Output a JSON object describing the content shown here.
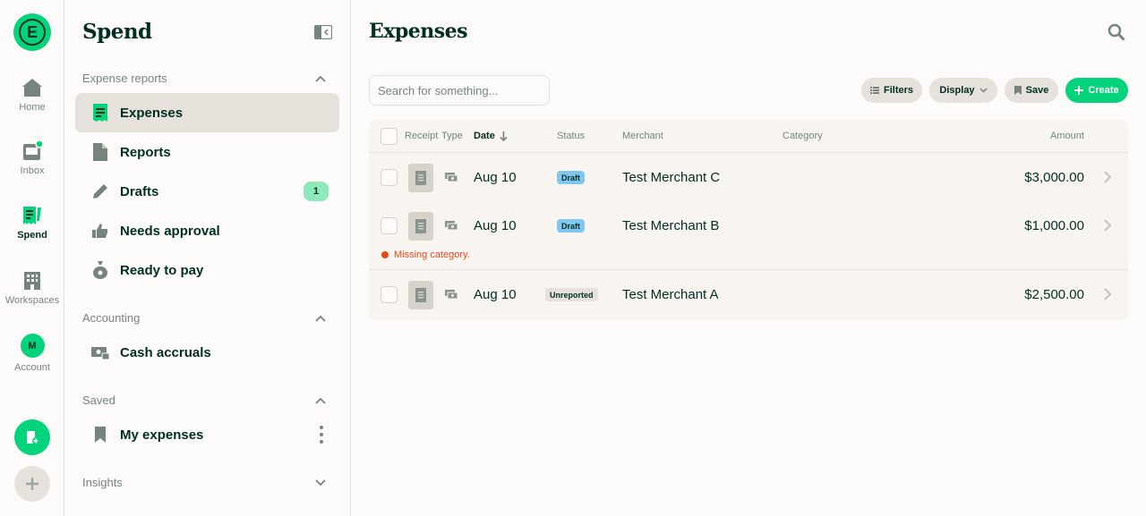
{
  "rail": {
    "logo_letter": "E",
    "items": [
      {
        "label": "Home",
        "icon": "home-icon"
      },
      {
        "label": "Inbox",
        "icon": "inbox-icon"
      },
      {
        "label": "Spend",
        "icon": "spend-icon"
      },
      {
        "label": "Workspaces",
        "icon": "building-icon"
      },
      {
        "label": "Account",
        "icon": "avatar"
      }
    ],
    "account_initial": "M"
  },
  "sidebar": {
    "title": "Spend",
    "sections": {
      "expense_reports": "Expense reports",
      "accounting": "Accounting",
      "saved": "Saved",
      "insights": "Insights"
    },
    "items": {
      "expenses": "Expenses",
      "reports": "Reports",
      "drafts": "Drafts",
      "drafts_count": "1",
      "needs_approval": "Needs approval",
      "ready_to_pay": "Ready to pay",
      "cash_accruals": "Cash accruals",
      "my_expenses": "My expenses"
    }
  },
  "main": {
    "title": "Expenses",
    "search_placeholder": "Search for something...",
    "buttons": {
      "filters": "Filters",
      "display": "Display",
      "save": "Save",
      "create": "Create"
    },
    "columns": {
      "receipt": "Receipt",
      "type": "Type",
      "date": "Date",
      "status": "Status",
      "merchant": "Merchant",
      "category": "Category",
      "amount": "Amount"
    },
    "rows": [
      {
        "date": "Aug 10",
        "status": "Draft",
        "merchant": "Test Merchant C",
        "amount": "$3,000.00"
      },
      {
        "date": "Aug 10",
        "status": "Draft",
        "merchant": "Test Merchant B",
        "amount": "$1,000.00",
        "warning": "Missing category."
      },
      {
        "date": "Aug 10",
        "status": "Unreported",
        "merchant": "Test Merchant A",
        "amount": "$2,500.00"
      }
    ]
  },
  "colors": {
    "brand_green": "#03d47c",
    "dark_text": "#002e22",
    "muted_text": "#76847e",
    "draft_badge": "#80c7f0",
    "error": "#e5491c"
  }
}
